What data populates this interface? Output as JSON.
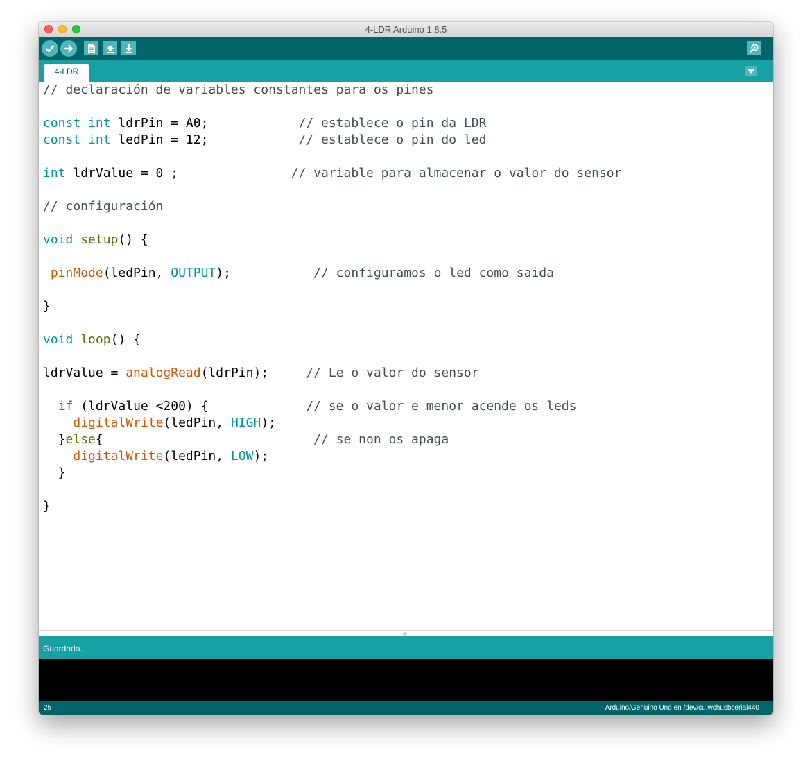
{
  "window": {
    "title": "4-LDR Arduino 1.8.5"
  },
  "toolbar": {
    "verify_icon": "check-icon",
    "upload_icon": "arrow-right-icon",
    "new_icon": "new-file-icon",
    "open_icon": "open-arrow-up-icon",
    "save_icon": "save-arrow-down-icon",
    "serial_monitor_icon": "magnifier-icon"
  },
  "tabs": [
    {
      "label": "4-LDR"
    }
  ],
  "editor": {
    "lines": [
      [
        [
          "c",
          "// declaración de variables constantes para os pines"
        ]
      ],
      [],
      [
        [
          "k",
          "const"
        ],
        [
          "t",
          " "
        ],
        [
          "k",
          "int"
        ],
        [
          "t",
          " ldrPin = A0;            "
        ],
        [
          "c",
          "// establece o pin da LDR"
        ]
      ],
      [
        [
          "k",
          "const"
        ],
        [
          "t",
          " "
        ],
        [
          "k",
          "int"
        ],
        [
          "t",
          " ledPin = 12;            "
        ],
        [
          "c",
          "// establece o pin do led"
        ]
      ],
      [],
      [
        [
          "k",
          "int"
        ],
        [
          "t",
          " ldrValue = 0 ;               "
        ],
        [
          "c",
          "// variable para almacenar o valor do sensor"
        ]
      ],
      [],
      [
        [
          "c",
          "// configuración"
        ]
      ],
      [],
      [
        [
          "k",
          "void"
        ],
        [
          "t",
          " "
        ],
        [
          "f",
          "setup"
        ],
        [
          "t",
          "() {"
        ]
      ],
      [],
      [
        [
          "t",
          " "
        ],
        [
          "o",
          "pinMode"
        ],
        [
          "t",
          "(ledPin, "
        ],
        [
          "k",
          "OUTPUT"
        ],
        [
          "t",
          ");           "
        ],
        [
          "c",
          "// configuramos o led como saida"
        ]
      ],
      [],
      [
        [
          "t",
          "}"
        ]
      ],
      [],
      [
        [
          "k",
          "void"
        ],
        [
          "t",
          " "
        ],
        [
          "f",
          "loop"
        ],
        [
          "t",
          "() {"
        ]
      ],
      [],
      [
        [
          "t",
          "ldrValue = "
        ],
        [
          "o",
          "analogRead"
        ],
        [
          "t",
          "(ldrPin);     "
        ],
        [
          "c",
          "// Le o valor do sensor"
        ]
      ],
      [],
      [
        [
          "t",
          "  "
        ],
        [
          "f",
          "if"
        ],
        [
          "t",
          " (ldrValue <200) {             "
        ],
        [
          "c",
          "// se o valor e menor acende os leds"
        ]
      ],
      [
        [
          "t",
          "    "
        ],
        [
          "o",
          "digitalWrite"
        ],
        [
          "t",
          "(ledPin, "
        ],
        [
          "k",
          "HIGH"
        ],
        [
          "t",
          ");"
        ]
      ],
      [
        [
          "t",
          "  }"
        ],
        [
          "f",
          "else"
        ],
        [
          "t",
          "{                            "
        ],
        [
          "c",
          "// se non os apaga"
        ]
      ],
      [
        [
          "t",
          "    "
        ],
        [
          "o",
          "digitalWrite"
        ],
        [
          "t",
          "(ledPin, "
        ],
        [
          "k",
          "LOW"
        ],
        [
          "t",
          ");"
        ]
      ],
      [
        [
          "t",
          "  }"
        ]
      ],
      [],
      [
        [
          "t",
          "}"
        ]
      ]
    ]
  },
  "syntax_colors": {
    "k": "#00979c",
    "f": "#5e6d03",
    "o": "#d35400",
    "c": "#434f54",
    "t": "#000000"
  },
  "status": {
    "message": "Guardado."
  },
  "footer": {
    "line_number": "25",
    "board": "Arduino/Genuino Uno en /dev/cu.wchusbserial440"
  },
  "colors": {
    "toolbar_bg": "#006468",
    "tabbar_bg": "#17a1a5",
    "button_bg": "#4db7bb",
    "console_bg": "#000000"
  }
}
